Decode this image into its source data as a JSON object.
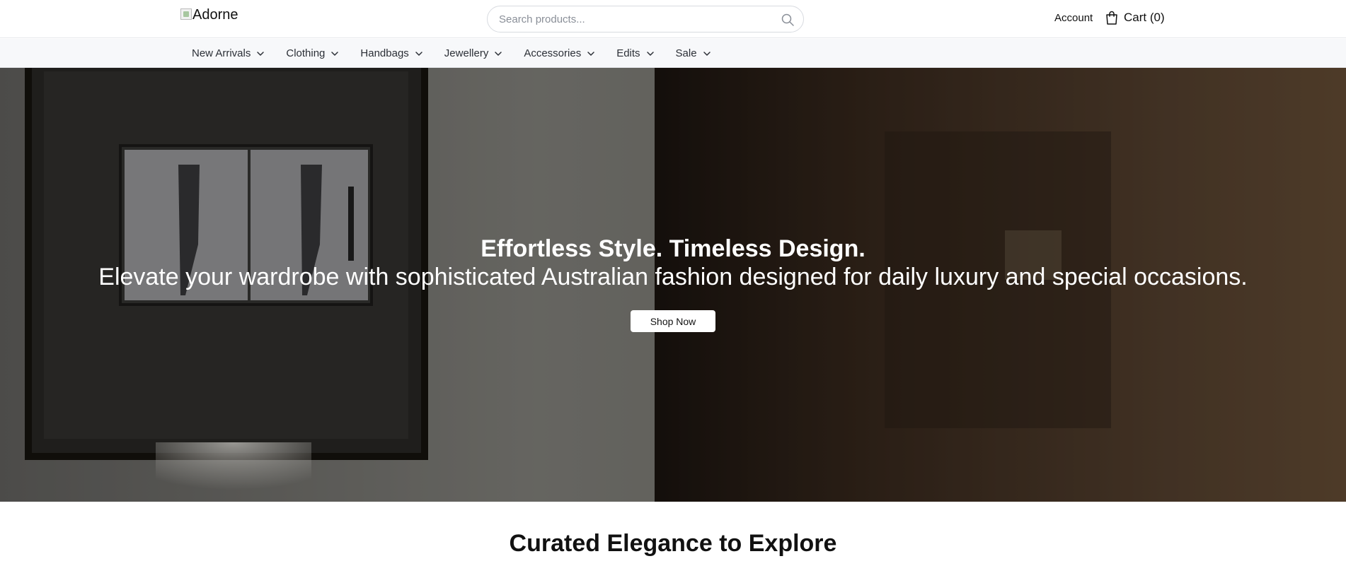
{
  "header": {
    "logo_text": "Adorne",
    "search_placeholder": "Search products...",
    "account_label": "Account",
    "cart_label": "Cart (0)"
  },
  "nav": {
    "items": [
      {
        "label": "New Arrivals"
      },
      {
        "label": "Clothing"
      },
      {
        "label": "Handbags"
      },
      {
        "label": "Jewellery"
      },
      {
        "label": "Accessories"
      },
      {
        "label": "Edits"
      },
      {
        "label": "Sale"
      }
    ]
  },
  "hero": {
    "title": "Effortless Style. Timeless Design.",
    "subtitle": "Elevate your wardrobe with sophisticated Australian fashion designed for daily luxury and special occasions.",
    "cta_label": "Shop Now"
  },
  "section": {
    "title": "Curated Elegance to Explore"
  },
  "icons": {
    "search": "search-icon",
    "cart": "shopping-bag-icon",
    "dropdown": "chevron-down-icon"
  },
  "colors": {
    "nav_bg": "#f7f8fa",
    "hero_warm": "#5a4330",
    "button_bg": "#ffffff"
  }
}
